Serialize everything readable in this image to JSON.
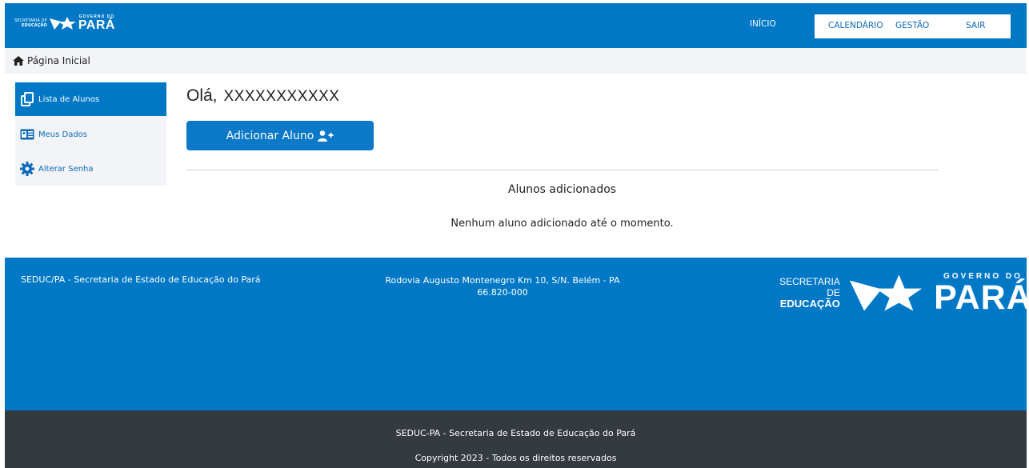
{
  "header": {
    "logo": {
      "secretaria_line1": "SECRETARIA DE",
      "secretaria_line2": "EDUCAÇÃO",
      "governo": "GOVERNO DO",
      "para": "PARÁ"
    },
    "nav": {
      "inicio": "INÍCIO",
      "calendario": "CALENDÁRIO",
      "gestao": "GESTÃO",
      "sair": "SAIR"
    }
  },
  "breadcrumb": {
    "icon": "home-icon",
    "label": "Página Inicial"
  },
  "sidebar": {
    "items": [
      {
        "label": "Lista de Alunos",
        "icon": "copy-icon",
        "active": true
      },
      {
        "label": "Meus Dados",
        "icon": "id-card-icon",
        "active": false
      },
      {
        "label": "Alterar Senha",
        "icon": "gear-icon",
        "active": false
      }
    ]
  },
  "main": {
    "greeting": "Olá,",
    "user_name": "XXXXXXXXXXX",
    "add_button": "Adicionar Aluno",
    "section_title": "Alunos adicionados",
    "empty_message": "Nenhum aluno adicionado até o momento."
  },
  "footer": {
    "org": "SEDUC/PA - Secretaria de Estado de Educação do Pará",
    "address_line1": "Rodovia Augusto Montenegro Km 10, S/N. Belém - PA",
    "address_line2": "66.820-000",
    "logo": {
      "secretaria_line1": "SECRETARIA DE",
      "secretaria_line2": "EDUCAÇÃO",
      "governo": "GOVERNO DO",
      "para": "PARÁ"
    }
  },
  "bottom": {
    "line1": "SEDUC-PA - Secretaria de Estado de Educação do Pará",
    "line2": "Copyright 2023 - Todos os direitos reservados"
  },
  "colors": {
    "primary": "#0078c6",
    "light_bg": "#f2f4f8",
    "dark_footer": "#343a40",
    "link": "#0b69b5"
  }
}
